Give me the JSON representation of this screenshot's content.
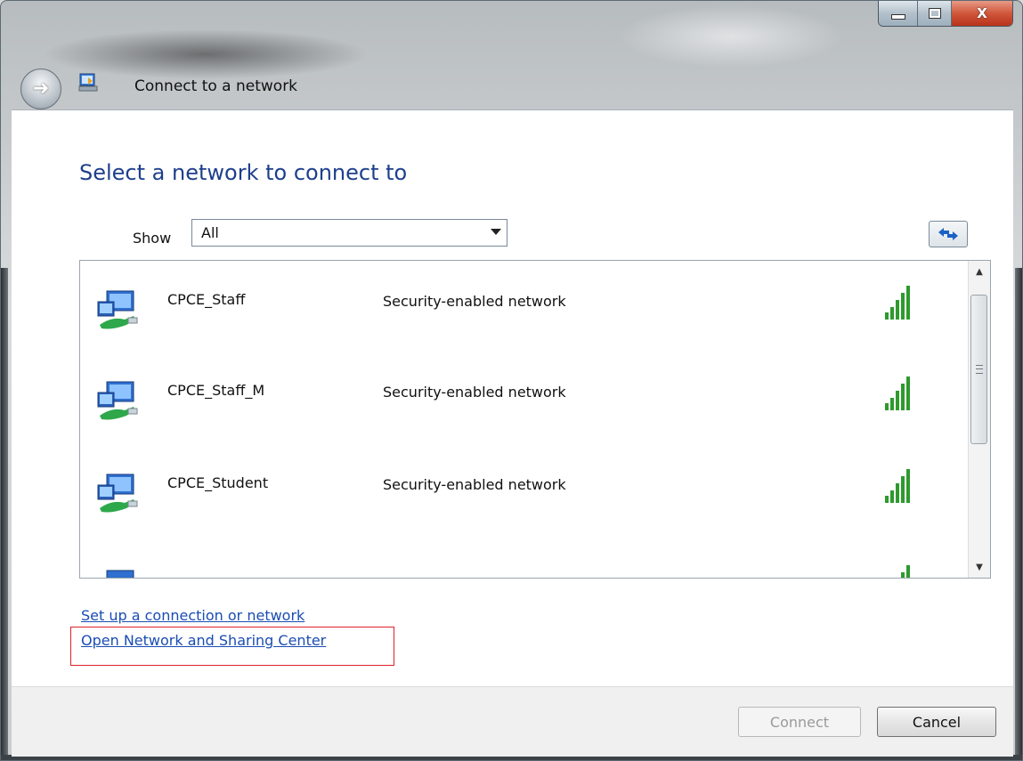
{
  "window": {
    "title": "Connect to a network",
    "close_glyph": "X"
  },
  "main": {
    "heading": "Select a network to connect to",
    "show_label": "Show",
    "show_value": "All"
  },
  "networks": [
    {
      "name": "CPCE_Staff",
      "security": "Security-enabled network",
      "signal_icon": "signal-strength-icon"
    },
    {
      "name": "CPCE_Staff_M",
      "security": "Security-enabled network",
      "signal_icon": "signal-strength-icon"
    },
    {
      "name": "CPCE_Student",
      "security": "Security-enabled network",
      "signal_icon": "signal-strength-icon"
    }
  ],
  "links": {
    "setup": "Set up a connection or network",
    "network_sharing": "Open Network and Sharing Center"
  },
  "footer": {
    "connect": "Connect",
    "cancel": "Cancel"
  },
  "colors": {
    "heading": "#1e3f8c",
    "link": "#1a4db3",
    "highlight": "#e0212b",
    "signal": "#2e9a2e"
  }
}
